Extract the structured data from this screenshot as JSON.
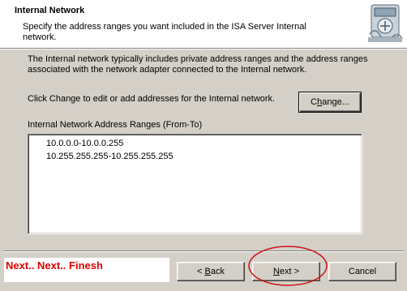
{
  "header": {
    "title": "Internal Network",
    "description": "Specify the address ranges you want included in the ISA Server Internal network."
  },
  "content": {
    "intro": "The Internal network typically includes private address ranges and the address ranges associated with the network adapter connected to the Internal network.",
    "change_instruction": "Click Change to edit or add addresses for the Internal network.",
    "change_button": "Change...",
    "ranges_label": "Internal Network Address Ranges (From-To)",
    "ranges": [
      "10.0.0.0-10.0.0.255",
      "10.255.255.255-10.255.255.255"
    ]
  },
  "annotation": {
    "text": "Next.. Next.. Finesh",
    "color": "#e00000"
  },
  "footer": {
    "back_button": "< Back",
    "next_button": "Next >",
    "cancel_button": "Cancel"
  },
  "icons": {
    "wizard": "isa-server-wizard-icon"
  }
}
